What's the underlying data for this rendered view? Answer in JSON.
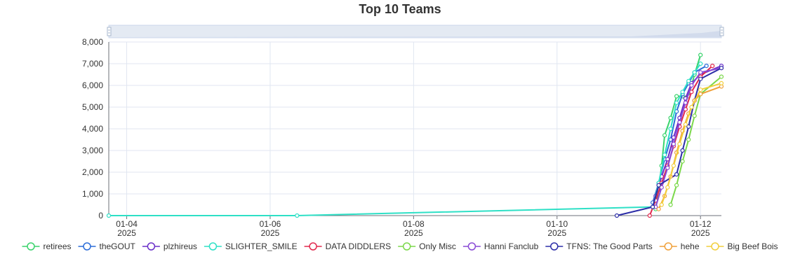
{
  "chart_data": {
    "type": "line",
    "title": "Top 10 Teams",
    "xlabel": "",
    "ylabel": "",
    "ylim": [
      0,
      8000
    ],
    "y_ticks": [
      0,
      1000,
      2000,
      3000,
      4000,
      5000,
      6000,
      7000,
      8000
    ],
    "y_tick_labels": [
      "0",
      "1,000",
      "2,000",
      "3,000",
      "4,000",
      "5,000",
      "6,000",
      "7,000",
      "8,000"
    ],
    "xlim": [
      "2025-01-03T18:00",
      "2025-01-12T07:00"
    ],
    "x_ticks": [
      {
        "date": "2025-01-04",
        "label": "01-04",
        "year": "2025"
      },
      {
        "date": "2025-01-06",
        "label": "01-06",
        "year": "2025"
      },
      {
        "date": "2025-01-08",
        "label": "01-08",
        "year": "2025"
      },
      {
        "date": "2025-01-10",
        "label": "01-10",
        "year": "2025"
      },
      {
        "date": "2025-01-12",
        "label": "01-12",
        "year": "2025"
      }
    ],
    "grid": true,
    "legend_position": "bottom",
    "data_zoom_slider": true,
    "series": [
      {
        "name": "retirees",
        "color": "#3ad46c",
        "points": [
          [
            "2025-01-11T09:00",
            300
          ],
          [
            "2025-01-11T10:00",
            1200
          ],
          [
            "2025-01-11T11:00",
            2300
          ],
          [
            "2025-01-11T12:00",
            3700
          ],
          [
            "2025-01-11T14:00",
            4500
          ],
          [
            "2025-01-11T16:00",
            5500
          ],
          [
            "2025-01-11T18:00",
            5500
          ],
          [
            "2025-01-11T20:00",
            5500
          ],
          [
            "2025-01-11T22:00",
            6500
          ],
          [
            "2025-01-12T00:00",
            7400
          ]
        ]
      },
      {
        "name": "theGOUT",
        "color": "#2a6cd8",
        "points": [
          [
            "2025-01-11T08:00",
            600
          ],
          [
            "2025-01-11T10:00",
            1500
          ],
          [
            "2025-01-11T12:00",
            2600
          ],
          [
            "2025-01-11T14:00",
            3500
          ],
          [
            "2025-01-11T16:00",
            4800
          ],
          [
            "2025-01-11T18:00",
            5600
          ],
          [
            "2025-01-11T20:00",
            6100
          ],
          [
            "2025-01-11T22:00",
            6600
          ],
          [
            "2025-01-12T02:00",
            6900
          ]
        ]
      },
      {
        "name": "plzhireus",
        "color": "#6a2fc9",
        "points": [
          [
            "2025-01-11T09:00",
            900
          ],
          [
            "2025-01-11T11:00",
            1800
          ],
          [
            "2025-01-11T13:00",
            2600
          ],
          [
            "2025-01-11T15:00",
            3600
          ],
          [
            "2025-01-11T17:00",
            4500
          ],
          [
            "2025-01-11T19:00",
            5400
          ],
          [
            "2025-01-11T21:00",
            6100
          ],
          [
            "2025-01-12T00:00",
            6500
          ],
          [
            "2025-01-12T07:00",
            6900
          ]
        ]
      },
      {
        "name": "SLIGHTER_SMILE",
        "color": "#2ee0c6",
        "points": [
          [
            "2025-01-03T18:00",
            0
          ],
          [
            "2025-01-06T09:00",
            0
          ],
          [
            "2025-01-11T08:00",
            400
          ],
          [
            "2025-01-11T10:00",
            1500
          ],
          [
            "2025-01-11T12:00",
            2800
          ],
          [
            "2025-01-11T14:00",
            4000
          ],
          [
            "2025-01-11T16:00",
            5200
          ],
          [
            "2025-01-11T18:00",
            5700
          ],
          [
            "2025-01-11T20:00",
            6200
          ],
          [
            "2025-01-11T22:00",
            6600
          ],
          [
            "2025-01-12T00:00",
            7000
          ]
        ]
      },
      {
        "name": "DATA DIDDLERS",
        "color": "#e2284d",
        "points": [
          [
            "2025-01-11T07:00",
            0
          ],
          [
            "2025-01-11T09:00",
            700
          ],
          [
            "2025-01-11T11:00",
            1500
          ],
          [
            "2025-01-11T13:00",
            2300
          ],
          [
            "2025-01-11T15:00",
            3200
          ],
          [
            "2025-01-11T17:00",
            4100
          ],
          [
            "2025-01-11T19:00",
            4900
          ],
          [
            "2025-01-11T21:00",
            5700
          ],
          [
            "2025-01-12T00:00",
            6400
          ],
          [
            "2025-01-12T04:00",
            6900
          ]
        ]
      },
      {
        "name": "Only Misc",
        "color": "#7bd84a",
        "points": [
          [
            "2025-01-11T14:00",
            500
          ],
          [
            "2025-01-11T16:00",
            1400
          ],
          [
            "2025-01-11T18:00",
            2500
          ],
          [
            "2025-01-11T20:00",
            3500
          ],
          [
            "2025-01-11T22:00",
            4600
          ],
          [
            "2025-01-12T00:00",
            5600
          ],
          [
            "2025-01-12T07:00",
            6400
          ]
        ]
      },
      {
        "name": "Hanni Fanclub",
        "color": "#8a4ad6",
        "points": [
          [
            "2025-01-11T09:00",
            400
          ],
          [
            "2025-01-11T11:00",
            1300
          ],
          [
            "2025-01-11T13:00",
            2200
          ],
          [
            "2025-01-11T15:00",
            3300
          ],
          [
            "2025-01-11T17:00",
            4300
          ],
          [
            "2025-01-11T19:00",
            5200
          ],
          [
            "2025-01-11T21:00",
            6000
          ],
          [
            "2025-01-12T00:00",
            6600
          ],
          [
            "2025-01-12T07:00",
            6800
          ]
        ]
      },
      {
        "name": "TFNS: The Good Parts",
        "color": "#2d2ea8",
        "points": [
          [
            "2025-01-10T20:00",
            0
          ],
          [
            "2025-01-11T08:00",
            400
          ],
          [
            "2025-01-11T10:00",
            1400
          ],
          [
            "2025-01-11T16:00",
            1900
          ],
          [
            "2025-01-11T18:00",
            3000
          ],
          [
            "2025-01-11T20:00",
            4100
          ],
          [
            "2025-01-11T22:00",
            5300
          ],
          [
            "2025-01-12T00:00",
            6300
          ],
          [
            "2025-01-12T07:00",
            6800
          ]
        ]
      },
      {
        "name": "hehe",
        "color": "#f0a13a",
        "points": [
          [
            "2025-01-11T10:00",
            300
          ],
          [
            "2025-01-11T12:00",
            900
          ],
          [
            "2025-01-11T14:00",
            1800
          ],
          [
            "2025-01-11T16:00",
            2900
          ],
          [
            "2025-01-11T18:00",
            3900
          ],
          [
            "2025-01-11T20:00",
            4700
          ],
          [
            "2025-01-11T22:00",
            5300
          ],
          [
            "2025-01-12T00:00",
            5600
          ],
          [
            "2025-01-12T07:00",
            5950
          ]
        ]
      },
      {
        "name": "Big Beef Bois",
        "color": "#f2cf3c",
        "points": [
          [
            "2025-01-11T11:00",
            500
          ],
          [
            "2025-01-11T13:00",
            1300
          ],
          [
            "2025-01-11T15:00",
            2300
          ],
          [
            "2025-01-11T17:00",
            3300
          ],
          [
            "2025-01-11T19:00",
            4200
          ],
          [
            "2025-01-11T21:00",
            5000
          ],
          [
            "2025-01-12T00:00",
            5800
          ],
          [
            "2025-01-12T07:00",
            6100
          ]
        ]
      }
    ]
  }
}
